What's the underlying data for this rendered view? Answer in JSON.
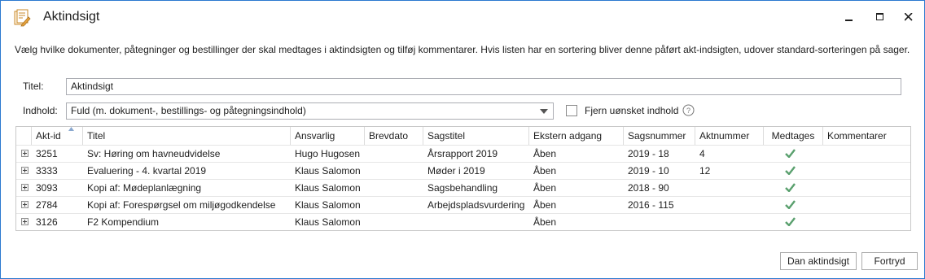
{
  "window": {
    "title": "Aktindsigt",
    "icon": "document-edit-icon"
  },
  "description": "Vælg hvilke dokumenter, påtegninger og bestillinger der skal medtages i aktindsigten og tilføj kommentarer. Hvis listen har en sortering bliver denne påført akt-indsigten, udover standard-sorteringen på sager.",
  "form": {
    "titel_label": "Titel:",
    "titel_value": "Aktindsigt",
    "indhold_label": "Indhold:",
    "indhold_value": "Fuld (m. dokument-, bestillings- og påtegningsindhold)",
    "fjern_label": "Fjern uønsket indhold",
    "fjern_checked": false
  },
  "grid": {
    "columns": [
      "Akt-id",
      "Titel",
      "Ansvarlig",
      "Brevdato",
      "Sagstitel",
      "Ekstern adgang",
      "Sagsnummer",
      "Aktnummer",
      "Medtages",
      "Kommentarer"
    ],
    "sorted_column": "Akt-id",
    "rows": [
      {
        "akt_id": "3251",
        "titel": "Sv: Høring om havneudvidelse",
        "ansvarlig": "Hugo Hugosen",
        "brevdato": "",
        "sagstitel": "Årsrapport 2019",
        "ekstern_adgang": "Åben",
        "sagsnummer": "2019 - 18",
        "aktnummer": "4",
        "medtages": true,
        "kommentarer": ""
      },
      {
        "akt_id": "3333",
        "titel": "Evaluering - 4. kvartal 2019",
        "ansvarlig": "Klaus Salomon",
        "brevdato": "",
        "sagstitel": "Møder i 2019",
        "ekstern_adgang": "Åben",
        "sagsnummer": "2019 - 10",
        "aktnummer": "12",
        "medtages": true,
        "kommentarer": ""
      },
      {
        "akt_id": "3093",
        "titel": "Kopi af: Mødeplanlægning",
        "ansvarlig": "Klaus Salomon",
        "brevdato": "",
        "sagstitel": "Sagsbehandling",
        "ekstern_adgang": "Åben",
        "sagsnummer": "2018 - 90",
        "aktnummer": "",
        "medtages": true,
        "kommentarer": ""
      },
      {
        "akt_id": "2784",
        "titel": "Kopi af: Forespørgsel om miljøgodkendelse",
        "ansvarlig": "Klaus Salomon",
        "brevdato": "",
        "sagstitel": "Arbejdspladsvurdering",
        "ekstern_adgang": "Åben",
        "sagsnummer": "2016 - 115",
        "aktnummer": "",
        "medtages": true,
        "kommentarer": ""
      },
      {
        "akt_id": "3126",
        "titel": "F2 Kompendium",
        "ansvarlig": "Klaus Salomon",
        "brevdato": "",
        "sagstitel": "",
        "ekstern_adgang": "Åben",
        "sagsnummer": "",
        "aktnummer": "",
        "medtages": true,
        "kommentarer": ""
      }
    ]
  },
  "buttons": {
    "dan": "Dan aktindsigt",
    "fortryd": "Fortryd"
  },
  "colors": {
    "window_border": "#2b79d0",
    "check": "#5aa06e",
    "icon_orange": "#e8a33d"
  }
}
